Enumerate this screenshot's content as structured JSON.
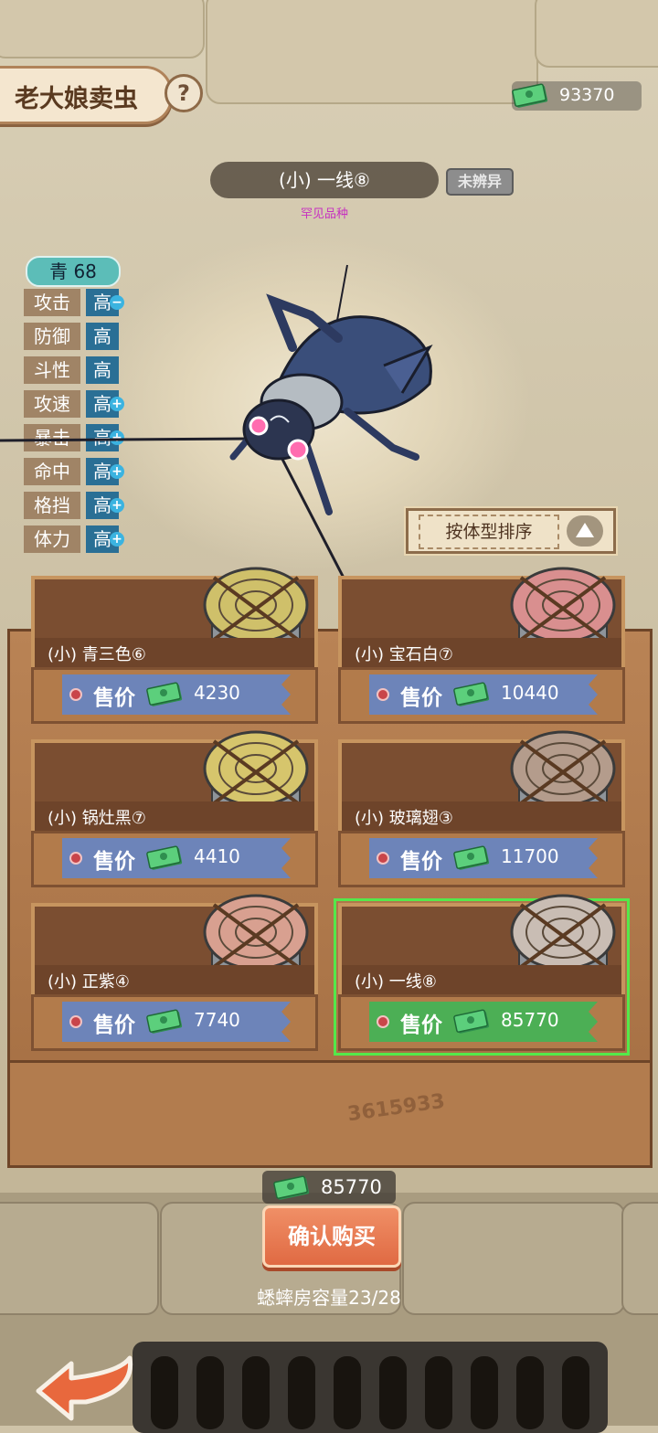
{
  "header": {
    "title": "老大娘卖虫",
    "help_glyph": "?",
    "money": "93370"
  },
  "cricket": {
    "name": "(小) 一线⑧",
    "status_badge": "未辨异",
    "rarity": "罕见品种",
    "grade": "青 68",
    "stats": [
      {
        "label": "攻击",
        "value": "高",
        "mark": "minus"
      },
      {
        "label": "防御",
        "value": "高",
        "mark": ""
      },
      {
        "label": "斗性",
        "value": "高",
        "mark": ""
      },
      {
        "label": "攻速",
        "value": "高",
        "mark": "plus"
      },
      {
        "label": "暴击",
        "value": "高",
        "mark": "plus"
      },
      {
        "label": "命中",
        "value": "高",
        "mark": "plus"
      },
      {
        "label": "格挡",
        "value": "高",
        "mark": "plus"
      },
      {
        "label": "体力",
        "value": "高",
        "mark": "plus"
      }
    ]
  },
  "sort_button": {
    "label": "按体型排序",
    "icon": "triangle-up-icon"
  },
  "price_label": "售价",
  "items": [
    {
      "name": "(小) 青三色⑥",
      "price": "4230",
      "jar_color": "#cfc06a",
      "selected": false
    },
    {
      "name": "(小) 宝石白⑦",
      "price": "10440",
      "jar_color": "#d98f8f",
      "selected": false
    },
    {
      "name": "(小) 锅灶黑⑦",
      "price": "4410",
      "jar_color": "#d6c56c",
      "selected": false
    },
    {
      "name": "(小) 玻璃翅③",
      "price": "11700",
      "jar_color": "#b49c8c",
      "selected": false
    },
    {
      "name": "(小) 正紫④",
      "price": "7740",
      "jar_color": "#d8a090",
      "selected": false
    },
    {
      "name": "(小) 一线⑧",
      "price": "85770",
      "jar_color": "#c9bdb4",
      "selected": true
    }
  ],
  "footer": {
    "total": "85770",
    "buy_label": "确认购买",
    "capacity": "蟋蟀房容量23/28"
  },
  "colors": {
    "tag_blue": "#6d84b9",
    "tag_green": "#4caf55",
    "buy_orange": "#e06a43",
    "rarity_magenta": "#c630c0"
  }
}
